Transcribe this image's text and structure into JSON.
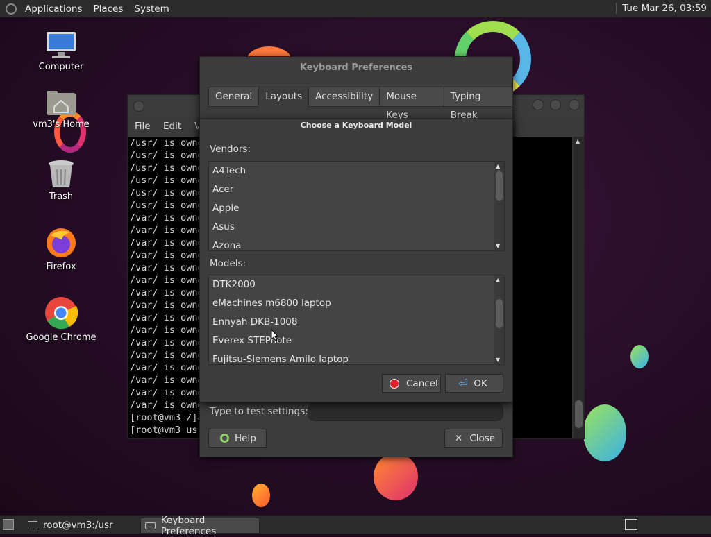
{
  "top_panel": {
    "menus": [
      "Applications",
      "Places",
      "System"
    ],
    "clock": "Tue Mar 26, 03:59"
  },
  "desktop_icons": [
    {
      "label": "Computer",
      "icon": "computer-icon"
    },
    {
      "label": "vm3's Home",
      "icon": "home-folder-icon"
    },
    {
      "label": "Trash",
      "icon": "trash-icon"
    },
    {
      "label": "Firefox",
      "icon": "firefox-icon"
    },
    {
      "label": "Google Chrome",
      "icon": "chrome-icon"
    }
  ],
  "terminal": {
    "menu": [
      "File",
      "Edit",
      "V"
    ],
    "lines": [
      "/usr/ is owne",
      "/usr/ is owne",
      "/usr/ is owne",
      "/usr/ is owne",
      "/usr/ is owne",
      "/usr/ is owne",
      "/var/ is owne",
      "/var/ is owne",
      "/var/ is owne",
      "/var/ is owne",
      "/var/ is owne",
      "/var/ is owne",
      "/var/ is owne",
      "/var/ is owne",
      "/var/ is owne",
      "/var/ is owne",
      "/var/ is owne",
      "/var/ is owne",
      "/var/ is owne",
      "/var/ is owne",
      "/var/ is owne",
      "/var/ is owne",
      "[root@vm3 /]#",
      "[root@vm3 usr"
    ]
  },
  "keyboard_prefs": {
    "title": "Keyboard Preferences",
    "tabs": [
      "General",
      "Layouts",
      "Accessibility",
      "Mouse Keys",
      "Typing Break"
    ],
    "active_tab": "Layouts",
    "test_label": "Type to test settings:",
    "help_label": "Help",
    "close_label": "Close"
  },
  "choose_model": {
    "title": "Choose a Keyboard Model",
    "vendors_label": "Vendors:",
    "vendors": [
      "A4Tech",
      "Acer",
      "Apple",
      "Asus",
      "Azona"
    ],
    "models_label": "Models:",
    "models": [
      "DTK2000",
      "eMachines m6800 laptop",
      "Ennyah DKB-1008",
      "Everex STEPnote",
      "Fujitsu-Siemens Amilo laptop"
    ],
    "cancel_label": "Cancel",
    "ok_label": "OK"
  },
  "taskbar": {
    "items": [
      "root@vm3:/usr",
      "Keyboard Preferences"
    ],
    "active_item": "Keyboard Preferences"
  },
  "colors": {
    "panel": "#2b2b2b",
    "dialog": "#3c3c3c",
    "cancel_red": "#e0202a",
    "ok_blue": "#5aa0e0"
  }
}
